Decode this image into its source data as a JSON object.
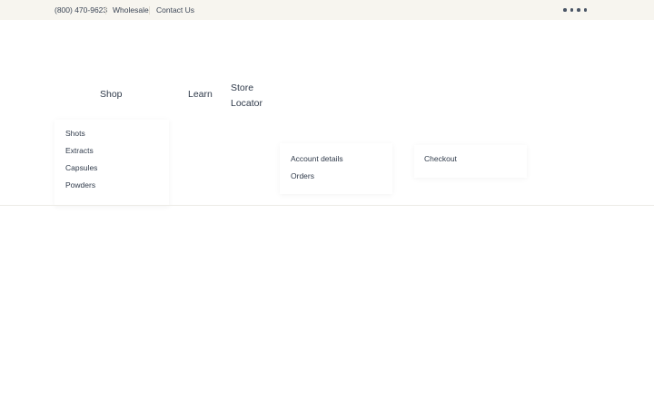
{
  "topbar": {
    "phone": "(800) 470-9623",
    "wholesale": "Wholesale",
    "contact": "Contact Us",
    "menu_icon": "more-dots-icon"
  },
  "nav": {
    "shop": "Shop",
    "learn": "Learn",
    "store_locator_line1": "Store",
    "store_locator_line2": "Locator"
  },
  "dropdowns": {
    "shop": [
      "Shots",
      "Extracts",
      "Capsules",
      "Powders"
    ],
    "account": [
      "Account details",
      "Orders"
    ],
    "checkout": [
      "Checkout"
    ]
  },
  "colors": {
    "topbar_bg": "#f7f5ef",
    "text": "#2f3a4a"
  }
}
